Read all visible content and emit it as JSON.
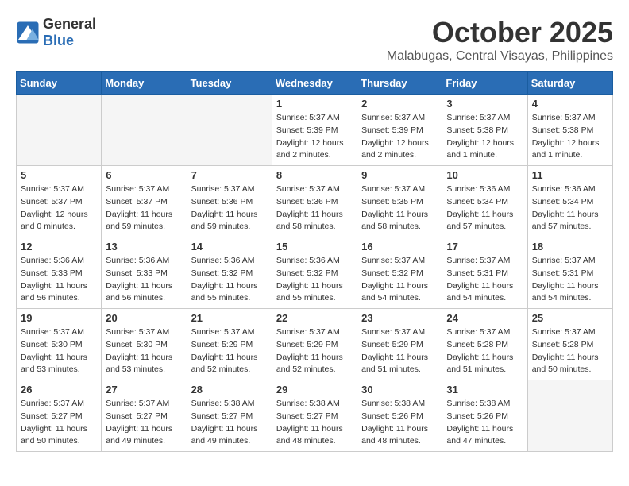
{
  "header": {
    "logo_general": "General",
    "logo_blue": "Blue",
    "month": "October 2025",
    "location": "Malabugas, Central Visayas, Philippines"
  },
  "weekdays": [
    "Sunday",
    "Monday",
    "Tuesday",
    "Wednesday",
    "Thursday",
    "Friday",
    "Saturday"
  ],
  "weeks": [
    [
      {
        "day": "",
        "sunrise": "",
        "sunset": "",
        "daylight": ""
      },
      {
        "day": "",
        "sunrise": "",
        "sunset": "",
        "daylight": ""
      },
      {
        "day": "",
        "sunrise": "",
        "sunset": "",
        "daylight": ""
      },
      {
        "day": "1",
        "sunrise": "Sunrise: 5:37 AM",
        "sunset": "Sunset: 5:39 PM",
        "daylight": "Daylight: 12 hours and 2 minutes."
      },
      {
        "day": "2",
        "sunrise": "Sunrise: 5:37 AM",
        "sunset": "Sunset: 5:39 PM",
        "daylight": "Daylight: 12 hours and 2 minutes."
      },
      {
        "day": "3",
        "sunrise": "Sunrise: 5:37 AM",
        "sunset": "Sunset: 5:38 PM",
        "daylight": "Daylight: 12 hours and 1 minute."
      },
      {
        "day": "4",
        "sunrise": "Sunrise: 5:37 AM",
        "sunset": "Sunset: 5:38 PM",
        "daylight": "Daylight: 12 hours and 1 minute."
      }
    ],
    [
      {
        "day": "5",
        "sunrise": "Sunrise: 5:37 AM",
        "sunset": "Sunset: 5:37 PM",
        "daylight": "Daylight: 12 hours and 0 minutes."
      },
      {
        "day": "6",
        "sunrise": "Sunrise: 5:37 AM",
        "sunset": "Sunset: 5:37 PM",
        "daylight": "Daylight: 11 hours and 59 minutes."
      },
      {
        "day": "7",
        "sunrise": "Sunrise: 5:37 AM",
        "sunset": "Sunset: 5:36 PM",
        "daylight": "Daylight: 11 hours and 59 minutes."
      },
      {
        "day": "8",
        "sunrise": "Sunrise: 5:37 AM",
        "sunset": "Sunset: 5:36 PM",
        "daylight": "Daylight: 11 hours and 58 minutes."
      },
      {
        "day": "9",
        "sunrise": "Sunrise: 5:37 AM",
        "sunset": "Sunset: 5:35 PM",
        "daylight": "Daylight: 11 hours and 58 minutes."
      },
      {
        "day": "10",
        "sunrise": "Sunrise: 5:36 AM",
        "sunset": "Sunset: 5:34 PM",
        "daylight": "Daylight: 11 hours and 57 minutes."
      },
      {
        "day": "11",
        "sunrise": "Sunrise: 5:36 AM",
        "sunset": "Sunset: 5:34 PM",
        "daylight": "Daylight: 11 hours and 57 minutes."
      }
    ],
    [
      {
        "day": "12",
        "sunrise": "Sunrise: 5:36 AM",
        "sunset": "Sunset: 5:33 PM",
        "daylight": "Daylight: 11 hours and 56 minutes."
      },
      {
        "day": "13",
        "sunrise": "Sunrise: 5:36 AM",
        "sunset": "Sunset: 5:33 PM",
        "daylight": "Daylight: 11 hours and 56 minutes."
      },
      {
        "day": "14",
        "sunrise": "Sunrise: 5:36 AM",
        "sunset": "Sunset: 5:32 PM",
        "daylight": "Daylight: 11 hours and 55 minutes."
      },
      {
        "day": "15",
        "sunrise": "Sunrise: 5:36 AM",
        "sunset": "Sunset: 5:32 PM",
        "daylight": "Daylight: 11 hours and 55 minutes."
      },
      {
        "day": "16",
        "sunrise": "Sunrise: 5:37 AM",
        "sunset": "Sunset: 5:32 PM",
        "daylight": "Daylight: 11 hours and 54 minutes."
      },
      {
        "day": "17",
        "sunrise": "Sunrise: 5:37 AM",
        "sunset": "Sunset: 5:31 PM",
        "daylight": "Daylight: 11 hours and 54 minutes."
      },
      {
        "day": "18",
        "sunrise": "Sunrise: 5:37 AM",
        "sunset": "Sunset: 5:31 PM",
        "daylight": "Daylight: 11 hours and 54 minutes."
      }
    ],
    [
      {
        "day": "19",
        "sunrise": "Sunrise: 5:37 AM",
        "sunset": "Sunset: 5:30 PM",
        "daylight": "Daylight: 11 hours and 53 minutes."
      },
      {
        "day": "20",
        "sunrise": "Sunrise: 5:37 AM",
        "sunset": "Sunset: 5:30 PM",
        "daylight": "Daylight: 11 hours and 53 minutes."
      },
      {
        "day": "21",
        "sunrise": "Sunrise: 5:37 AM",
        "sunset": "Sunset: 5:29 PM",
        "daylight": "Daylight: 11 hours and 52 minutes."
      },
      {
        "day": "22",
        "sunrise": "Sunrise: 5:37 AM",
        "sunset": "Sunset: 5:29 PM",
        "daylight": "Daylight: 11 hours and 52 minutes."
      },
      {
        "day": "23",
        "sunrise": "Sunrise: 5:37 AM",
        "sunset": "Sunset: 5:29 PM",
        "daylight": "Daylight: 11 hours and 51 minutes."
      },
      {
        "day": "24",
        "sunrise": "Sunrise: 5:37 AM",
        "sunset": "Sunset: 5:28 PM",
        "daylight": "Daylight: 11 hours and 51 minutes."
      },
      {
        "day": "25",
        "sunrise": "Sunrise: 5:37 AM",
        "sunset": "Sunset: 5:28 PM",
        "daylight": "Daylight: 11 hours and 50 minutes."
      }
    ],
    [
      {
        "day": "26",
        "sunrise": "Sunrise: 5:37 AM",
        "sunset": "Sunset: 5:27 PM",
        "daylight": "Daylight: 11 hours and 50 minutes."
      },
      {
        "day": "27",
        "sunrise": "Sunrise: 5:37 AM",
        "sunset": "Sunset: 5:27 PM",
        "daylight": "Daylight: 11 hours and 49 minutes."
      },
      {
        "day": "28",
        "sunrise": "Sunrise: 5:38 AM",
        "sunset": "Sunset: 5:27 PM",
        "daylight": "Daylight: 11 hours and 49 minutes."
      },
      {
        "day": "29",
        "sunrise": "Sunrise: 5:38 AM",
        "sunset": "Sunset: 5:27 PM",
        "daylight": "Daylight: 11 hours and 48 minutes."
      },
      {
        "day": "30",
        "sunrise": "Sunrise: 5:38 AM",
        "sunset": "Sunset: 5:26 PM",
        "daylight": "Daylight: 11 hours and 48 minutes."
      },
      {
        "day": "31",
        "sunrise": "Sunrise: 5:38 AM",
        "sunset": "Sunset: 5:26 PM",
        "daylight": "Daylight: 11 hours and 47 minutes."
      },
      {
        "day": "",
        "sunrise": "",
        "sunset": "",
        "daylight": ""
      }
    ]
  ]
}
